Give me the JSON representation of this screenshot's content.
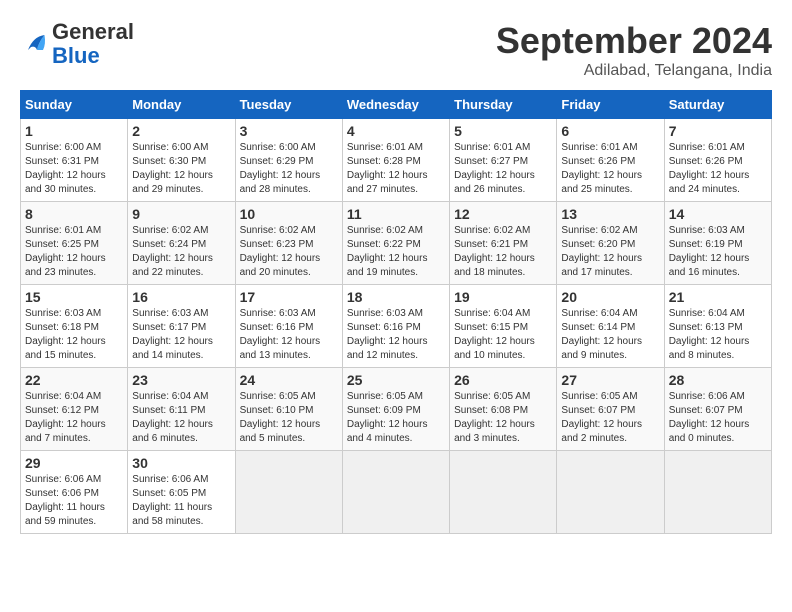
{
  "header": {
    "logo": {
      "general": "General",
      "blue": "Blue"
    },
    "title": "September 2024",
    "location": "Adilabad, Telangana, India"
  },
  "calendar": {
    "days_of_week": [
      "Sunday",
      "Monday",
      "Tuesday",
      "Wednesday",
      "Thursday",
      "Friday",
      "Saturday"
    ],
    "weeks": [
      [
        {
          "day": "",
          "info": ""
        },
        {
          "day": "2",
          "info": "Sunrise: 6:00 AM\nSunset: 6:30 PM\nDaylight: 12 hours\nand 29 minutes."
        },
        {
          "day": "3",
          "info": "Sunrise: 6:00 AM\nSunset: 6:29 PM\nDaylight: 12 hours\nand 28 minutes."
        },
        {
          "day": "4",
          "info": "Sunrise: 6:01 AM\nSunset: 6:28 PM\nDaylight: 12 hours\nand 27 minutes."
        },
        {
          "day": "5",
          "info": "Sunrise: 6:01 AM\nSunset: 6:27 PM\nDaylight: 12 hours\nand 26 minutes."
        },
        {
          "day": "6",
          "info": "Sunrise: 6:01 AM\nSunset: 6:26 PM\nDaylight: 12 hours\nand 25 minutes."
        },
        {
          "day": "7",
          "info": "Sunrise: 6:01 AM\nSunset: 6:26 PM\nDaylight: 12 hours\nand 24 minutes."
        }
      ],
      [
        {
          "day": "1",
          "info": "Sunrise: 6:00 AM\nSunset: 6:31 PM\nDaylight: 12 hours\nand 30 minutes."
        },
        {
          "day": "",
          "info": ""
        },
        {
          "day": "",
          "info": ""
        },
        {
          "day": "",
          "info": ""
        },
        {
          "day": "",
          "info": ""
        },
        {
          "day": "",
          "info": ""
        },
        {
          "day": "",
          "info": ""
        }
      ],
      [
        {
          "day": "8",
          "info": "Sunrise: 6:01 AM\nSunset: 6:25 PM\nDaylight: 12 hours\nand 23 minutes."
        },
        {
          "day": "9",
          "info": "Sunrise: 6:02 AM\nSunset: 6:24 PM\nDaylight: 12 hours\nand 22 minutes."
        },
        {
          "day": "10",
          "info": "Sunrise: 6:02 AM\nSunset: 6:23 PM\nDaylight: 12 hours\nand 20 minutes."
        },
        {
          "day": "11",
          "info": "Sunrise: 6:02 AM\nSunset: 6:22 PM\nDaylight: 12 hours\nand 19 minutes."
        },
        {
          "day": "12",
          "info": "Sunrise: 6:02 AM\nSunset: 6:21 PM\nDaylight: 12 hours\nand 18 minutes."
        },
        {
          "day": "13",
          "info": "Sunrise: 6:02 AM\nSunset: 6:20 PM\nDaylight: 12 hours\nand 17 minutes."
        },
        {
          "day": "14",
          "info": "Sunrise: 6:03 AM\nSunset: 6:19 PM\nDaylight: 12 hours\nand 16 minutes."
        }
      ],
      [
        {
          "day": "15",
          "info": "Sunrise: 6:03 AM\nSunset: 6:18 PM\nDaylight: 12 hours\nand 15 minutes."
        },
        {
          "day": "16",
          "info": "Sunrise: 6:03 AM\nSunset: 6:17 PM\nDaylight: 12 hours\nand 14 minutes."
        },
        {
          "day": "17",
          "info": "Sunrise: 6:03 AM\nSunset: 6:16 PM\nDaylight: 12 hours\nand 13 minutes."
        },
        {
          "day": "18",
          "info": "Sunrise: 6:03 AM\nSunset: 6:16 PM\nDaylight: 12 hours\nand 12 minutes."
        },
        {
          "day": "19",
          "info": "Sunrise: 6:04 AM\nSunset: 6:15 PM\nDaylight: 12 hours\nand 10 minutes."
        },
        {
          "day": "20",
          "info": "Sunrise: 6:04 AM\nSunset: 6:14 PM\nDaylight: 12 hours\nand 9 minutes."
        },
        {
          "day": "21",
          "info": "Sunrise: 6:04 AM\nSunset: 6:13 PM\nDaylight: 12 hours\nand 8 minutes."
        }
      ],
      [
        {
          "day": "22",
          "info": "Sunrise: 6:04 AM\nSunset: 6:12 PM\nDaylight: 12 hours\nand 7 minutes."
        },
        {
          "day": "23",
          "info": "Sunrise: 6:04 AM\nSunset: 6:11 PM\nDaylight: 12 hours\nand 6 minutes."
        },
        {
          "day": "24",
          "info": "Sunrise: 6:05 AM\nSunset: 6:10 PM\nDaylight: 12 hours\nand 5 minutes."
        },
        {
          "day": "25",
          "info": "Sunrise: 6:05 AM\nSunset: 6:09 PM\nDaylight: 12 hours\nand 4 minutes."
        },
        {
          "day": "26",
          "info": "Sunrise: 6:05 AM\nSunset: 6:08 PM\nDaylight: 12 hours\nand 3 minutes."
        },
        {
          "day": "27",
          "info": "Sunrise: 6:05 AM\nSunset: 6:07 PM\nDaylight: 12 hours\nand 2 minutes."
        },
        {
          "day": "28",
          "info": "Sunrise: 6:06 AM\nSunset: 6:07 PM\nDaylight: 12 hours\nand 0 minutes."
        }
      ],
      [
        {
          "day": "29",
          "info": "Sunrise: 6:06 AM\nSunset: 6:06 PM\nDaylight: 11 hours\nand 59 minutes."
        },
        {
          "day": "30",
          "info": "Sunrise: 6:06 AM\nSunset: 6:05 PM\nDaylight: 11 hours\nand 58 minutes."
        },
        {
          "day": "",
          "info": ""
        },
        {
          "day": "",
          "info": ""
        },
        {
          "day": "",
          "info": ""
        },
        {
          "day": "",
          "info": ""
        },
        {
          "day": "",
          "info": ""
        }
      ]
    ]
  }
}
